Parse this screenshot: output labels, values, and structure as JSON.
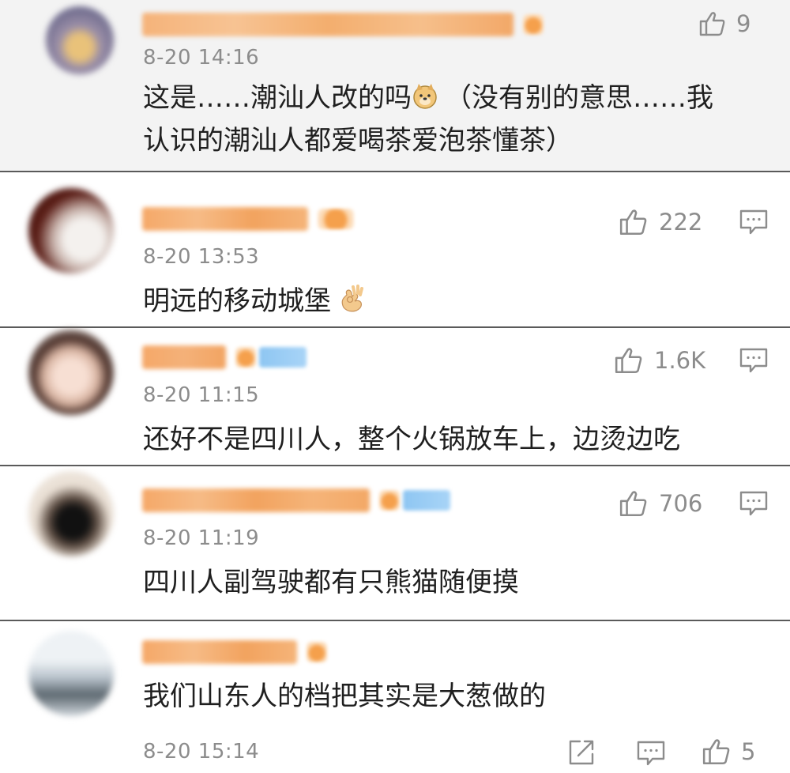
{
  "comments": [
    {
      "time": "8-20 14:16",
      "likes": "9",
      "text_line1": "这是……潮汕人改的吗",
      "text_line1_rest": "（没有别的意思……我",
      "text_line2": "认识的潮汕人都爱喝茶爱泡茶懂茶）",
      "emoji": "doge-emoji-icon"
    },
    {
      "time": "8-20 13:53",
      "likes": "222",
      "text": "明远的移动城堡",
      "emoji": "ok-hand-emoji-icon"
    },
    {
      "time": "8-20 11:15",
      "likes": "1.6K",
      "text": "还好不是四川人，整个火锅放车上，边烫边吃"
    },
    {
      "time": "8-20 11:19",
      "likes": "706",
      "text": "四川人副驾驶都有只熊猫随便摸"
    },
    {
      "time": "8-20 15:14",
      "likes": "5",
      "text": "我们山东人的档把其实是大葱做的"
    }
  ],
  "icons": {
    "like": "thumbs-up-icon",
    "reply": "comment-bubble-icon",
    "share": "share-icon"
  },
  "colors": {
    "meta_gray": "#8c8c8c",
    "username_orange": "#f29a52",
    "highlight_bg": "#f3f3f3",
    "divider": "#5a5a5a"
  }
}
